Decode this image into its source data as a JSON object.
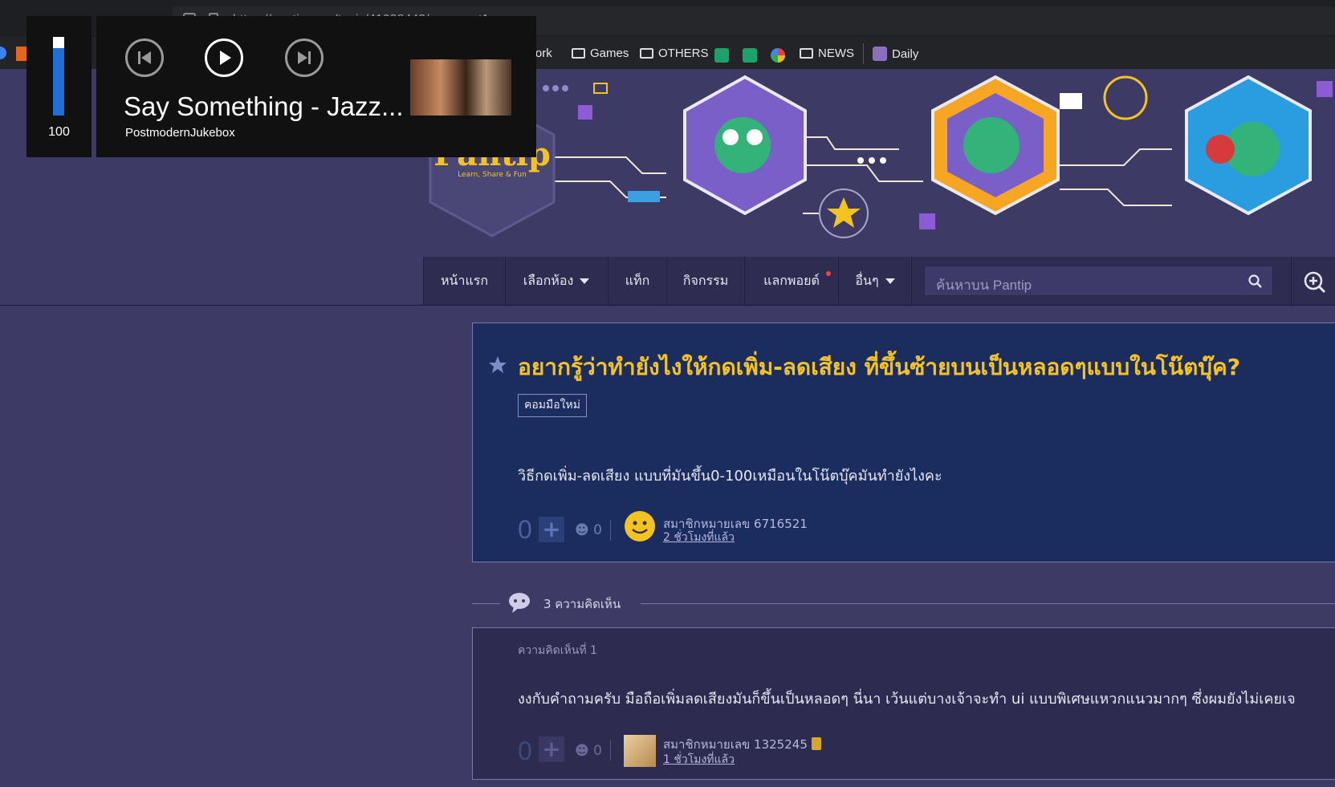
{
  "browser": {
    "url": "https://pantip.com/topic/41038443/comment1",
    "bookmarks": [
      {
        "label": "Work",
        "icon": "folder-icon"
      },
      {
        "label": "Games",
        "icon": "folder-icon"
      },
      {
        "label": "OTHERS",
        "icon": "folder-icon"
      },
      {
        "label": "NEWS",
        "icon": "folder-icon"
      },
      {
        "label": "Daily",
        "icon": "daily-favicon"
      }
    ]
  },
  "media": {
    "volume": "100",
    "title": "Say Something - Jazz...",
    "artist": "PostmodernJukebox"
  },
  "site": {
    "logo_text": "Pantip",
    "logo_tagline": "Learn, Share & Fun",
    "nav": [
      {
        "label": "หน้าแรก",
        "dropdown": false
      },
      {
        "label": "เลือกห้อง",
        "dropdown": true
      },
      {
        "label": "แท็ก",
        "dropdown": false
      },
      {
        "label": "กิจกรรม",
        "dropdown": false
      },
      {
        "label": "แลกพอยต์",
        "dropdown": false
      },
      {
        "label": "อื่นๆ",
        "dropdown": true
      }
    ],
    "search_placeholder": "ค้นหาบน Pantip"
  },
  "post": {
    "title": "อยากรู้ว่าทำยังไงให้กดเพิ่ม-ลดเสียง ที่ขึ้นซ้ายบนเป็นหลอดๆแบบในโน๊ตบุ๊ค?",
    "tag": "คอมมือใหม่",
    "body": "วิธีกดเพิ่ม-ลดเสียง แบบที่มันขึ้น0-100เหมือนในโน๊ตบุ๊คมันทำยังไงคะ",
    "score": "0",
    "emotion_count": "0",
    "author": "สมาชิกหมายเลข 6716521",
    "time": "2 ชั่วโมงที่แล้ว"
  },
  "comments": {
    "count_label": "3 ความคิดเห็น",
    "items": [
      {
        "label": "ความคิดเห็นที่ 1",
        "body": "งงกับคำถามครับ มือถือเพิ่มลดเสียงมันก็ขึ้นเป็นหลอดๆ นี่นา เว้นแต่บางเจ้าจะทำ ui แบบพิเศษแหวกแนวมากๆ ซึ่งผมยังไม่เคยเจ",
        "score": "0",
        "emotion_count": "0",
        "author": "สมาชิกหมายเลข 1325245",
        "time": "1 ชั่วโมงที่แล้ว"
      }
    ]
  },
  "colors": {
    "page_bg": "#3e3a66",
    "post_bg": "#1b2d5e",
    "title_color": "#f5c320",
    "volume_bar": "#1f6fd6"
  }
}
